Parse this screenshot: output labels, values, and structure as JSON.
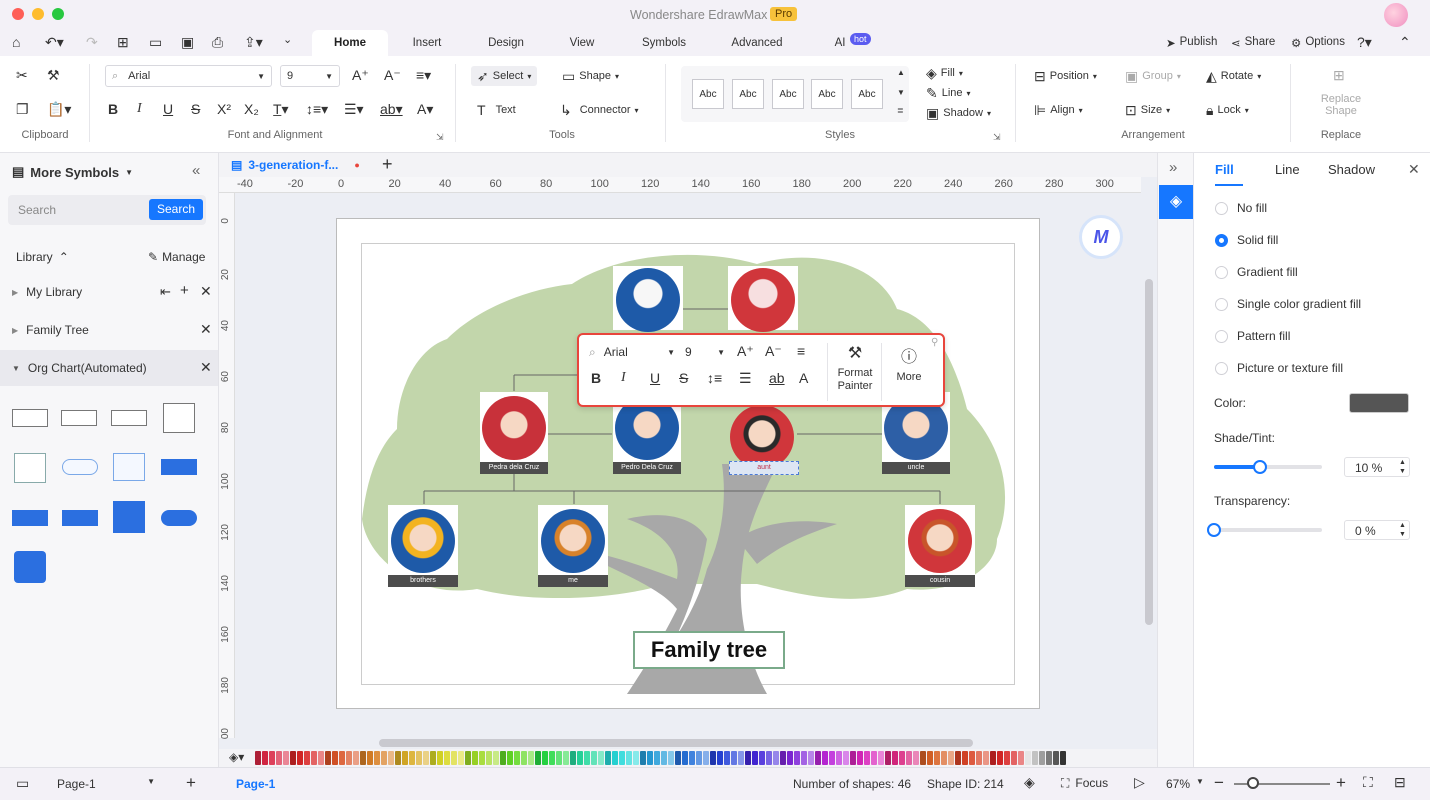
{
  "app": {
    "title": "Wondershare EdrawMax",
    "badge": "Pro"
  },
  "menu": {
    "tabs": [
      "Home",
      "Insert",
      "Design",
      "View",
      "Symbols",
      "Advanced",
      "AI"
    ],
    "ai_badge": "hot",
    "publish": "Publish",
    "share": "Share",
    "options": "Options"
  },
  "ribbon": {
    "clipboard_label": "Clipboard",
    "font": {
      "name": "Arial",
      "size": "9",
      "group_label": "Font and Alignment"
    },
    "tools": {
      "select": "Select",
      "shape": "Shape",
      "text": "Text",
      "connector": "Connector",
      "group_label": "Tools"
    },
    "styles": {
      "box_text": "Abc",
      "fill": "Fill",
      "line": "Line",
      "shadow": "Shadow",
      "group_label": "Styles"
    },
    "arrangement": {
      "position": "Position",
      "group": "Group",
      "rotate": "Rotate",
      "align": "Align",
      "size": "Size",
      "lock": "Lock",
      "group_label": "Arrangement"
    },
    "replace": {
      "button": "Replace Shape",
      "group_label": "Replace"
    }
  },
  "left": {
    "title": "More Symbols",
    "search_placeholder": "Search",
    "search_button": "Search",
    "library": "Library",
    "manage": "Manage",
    "items": [
      "My Library",
      "Family Tree",
      "Org Chart(Automated)"
    ]
  },
  "doc": {
    "tab_name": "3-generation-f..."
  },
  "ruler": {
    "h": [
      "-40",
      "-20",
      "0",
      "20",
      "40",
      "60",
      "80",
      "100",
      "120",
      "140",
      "160",
      "180",
      "200",
      "220",
      "240",
      "260",
      "280",
      "300"
    ],
    "v": [
      "0",
      "20",
      "40",
      "60",
      "80",
      "100",
      "120",
      "140",
      "160",
      "180",
      "00"
    ]
  },
  "diagram": {
    "title": "Family tree",
    "labels": {
      "p1": "Pedra dela Cruz",
      "p2": "Pedro Dela Cruz",
      "aunt": "aunt",
      "uncle": "uncle",
      "brothers": "brothers",
      "me": "me",
      "cousin": "cousin"
    }
  },
  "float_toolbar": {
    "font": "Arial",
    "size": "9",
    "format_painter": "Format Painter",
    "more": "More"
  },
  "right": {
    "tabs": [
      "Fill",
      "Line",
      "Shadow"
    ],
    "options": [
      "No fill",
      "Solid fill",
      "Gradient fill",
      "Single color gradient fill",
      "Pattern fill",
      "Picture or texture fill"
    ],
    "selected": "Solid fill",
    "color_label": "Color:",
    "color": "#555555",
    "shade_label": "Shade/Tint:",
    "shade_value": "10 %",
    "shade_level": 0.43,
    "transparency_label": "Transparency:",
    "transparency_value": "0 %",
    "transparency_level": 0
  },
  "status": {
    "page_select": "Page-1",
    "page_tab": "Page-1",
    "shapes": "Number of shapes: 46",
    "shape_id": "Shape ID: 214",
    "focus": "Focus",
    "zoom": "67%"
  },
  "colors": {
    "accent": "#1677ff",
    "tree_green": "#b7cf9c",
    "trunk": "#a8a8a8",
    "highlight": "#e8453c"
  }
}
